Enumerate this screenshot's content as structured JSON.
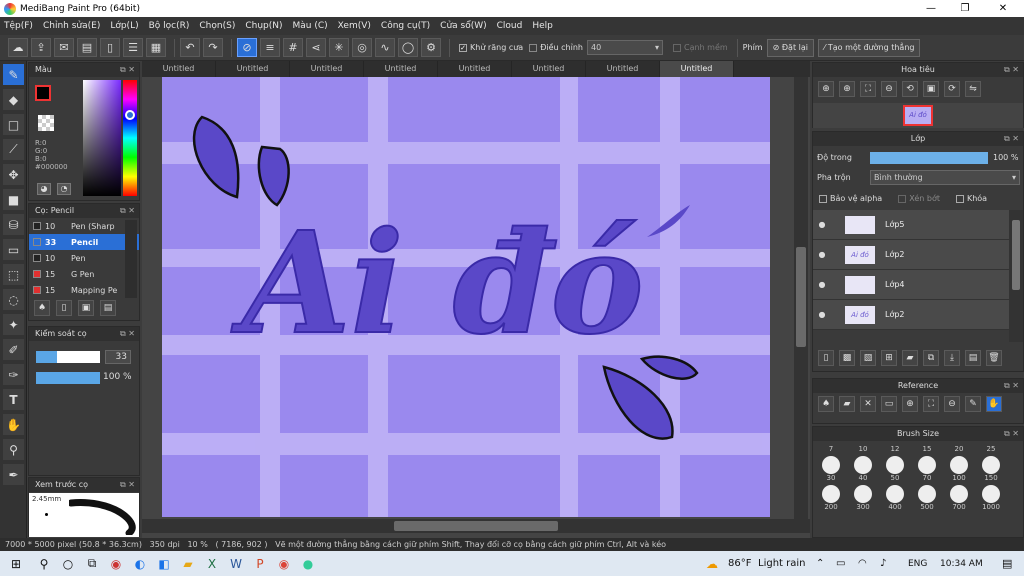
{
  "window": {
    "title": "MediBang Paint Pro (64bit)",
    "minimize": "—",
    "maximize": "❐",
    "close": "✕"
  },
  "menu": [
    "Tệp(F)",
    "Chỉnh sửa(E)",
    "Lớp(L)",
    "Bộ lọc(R)",
    "Chọn(S)",
    "Chụp(N)",
    "Màu (C)",
    "Xem(V)",
    "Công cụ(T)",
    "Cửa sổ(W)",
    "Cloud",
    "Help"
  ],
  "toolbar": {
    "antialias_label": "Khử răng cưa",
    "adjust_label": "Điều chỉnh",
    "adjust_value": "40",
    "edge_label": "Cạnh mềm",
    "key_label": "Phím",
    "reset_label": "Đặt lại",
    "line_label": "Tạo một đường thẳng"
  },
  "tabs": [
    "Untitled",
    "Untitled",
    "Untitled",
    "Untitled",
    "Untitled",
    "Untitled",
    "Untitled",
    "Untitled"
  ],
  "color_panel": {
    "title": "Màu",
    "r": "R:0",
    "g": "G:0",
    "b": "B:0",
    "hex": "#000000"
  },
  "brush_panel": {
    "title": "Cọ: Pencil",
    "items": [
      {
        "size": "10",
        "name": "Pen (Sharp",
        "color": "#222222"
      },
      {
        "size": "33",
        "name": "Pencil",
        "color": "#2a6fd6"
      },
      {
        "size": "10",
        "name": "Pen",
        "color": "#222222"
      },
      {
        "size": "15",
        "name": "G Pen",
        "color": "#e03030"
      },
      {
        "size": "15",
        "name": "Mapping Pe",
        "color": "#e03030"
      }
    ]
  },
  "brush_control": {
    "title": "Kiểm soát cọ",
    "size_value": "33",
    "opacity_value": "100 %",
    "size_fill": 0.33,
    "opacity_fill": 1.0
  },
  "preview": {
    "title": "Xem trước cọ",
    "size_label": "2.45mm"
  },
  "navigator": {
    "title": "Hoa tiêu",
    "thumb_text": "Ai đó"
  },
  "layers": {
    "title": "Lớp",
    "opacity_label": "Độ trong",
    "opacity_value": "100 %",
    "blend_label": "Pha trộn",
    "blend_value": "Bình thường",
    "protect_alpha": "Bảo vệ alpha",
    "clip": "Xén bớt",
    "lock": "Khóa",
    "items": [
      {
        "name": "Lớp5",
        "thumb": ""
      },
      {
        "name": "Lớp2",
        "thumb": "Ai đó"
      },
      {
        "name": "Lớp4",
        "thumb": ""
      },
      {
        "name": "Lớp2",
        "thumb": "Ai đó"
      }
    ]
  },
  "reference": {
    "title": "Reference"
  },
  "brush_size": {
    "title": "Brush Size",
    "top_labels": [
      "7",
      "10",
      "12",
      "15",
      "20",
      "25"
    ],
    "row1": [
      "30",
      "40",
      "50",
      "70",
      "100",
      "150"
    ],
    "row2": [
      "200",
      "300",
      "400",
      "500",
      "700",
      "1000"
    ]
  },
  "canvas": {
    "text": "Ai đó",
    "background": "#9a89ee",
    "stroke_color": "#5a48c8"
  },
  "status": {
    "size": "7000 * 5000 pixel",
    "physical": "(50.8 * 36.3cm)",
    "dpi": "350 dpi",
    "zoom": "10 %",
    "coords": "( 7186, 902 )",
    "hint": "Vẽ một đường thẳng bằng cách giữ phím Shift, Thay đổi cỡ cọ bằng cách giữ phím Ctrl, Alt và kéo"
  },
  "taskbar": {
    "weather_temp": "86°F",
    "weather_text": "Light rain",
    "lang": "ENG",
    "time": "10:34 AM"
  }
}
